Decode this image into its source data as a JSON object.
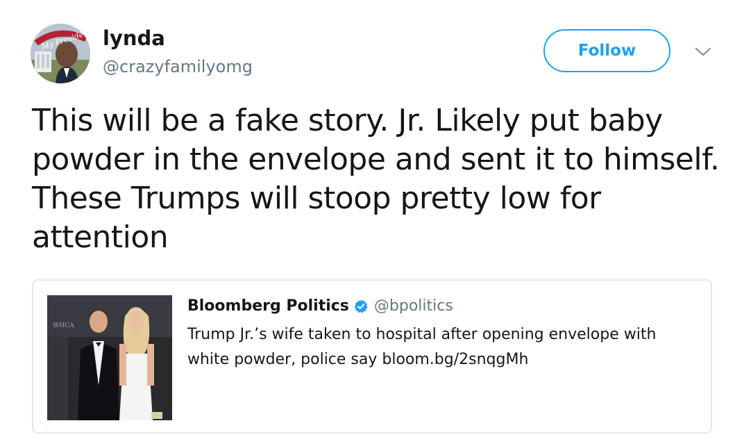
{
  "author": {
    "display_name": "lynda",
    "handle": "@crazyfamilyomg",
    "avatar_text": "My President"
  },
  "actions": {
    "follow_label": "Follow",
    "menu_icon": "chevron-down-icon"
  },
  "tweet": {
    "text": "This will be a fake story. Jr. Likely put baby powder in the envelope and sent it to himself. These Trumps will stoop pretty low for attention"
  },
  "quoted": {
    "display_name": "Bloomberg Politics",
    "verified_icon": "verified-badge-icon",
    "handle": "@bpolitics",
    "text": "Trump Jr.’s wife taken to hospital after opening envelope with white powder, police say bloom.bg/2snqgMh",
    "thumbnail_backdrop_text": "WHCA"
  },
  "colors": {
    "accent": "#1da1f2",
    "text_primary": "#14171a",
    "text_secondary": "#657786",
    "border": "#e1e8ed"
  }
}
